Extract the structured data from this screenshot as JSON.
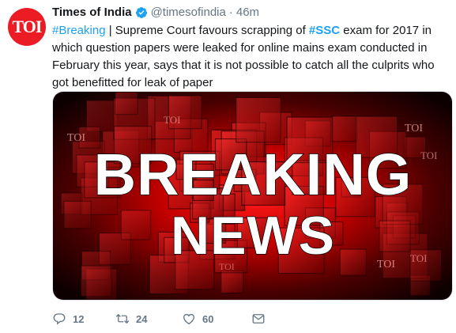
{
  "account": {
    "avatar_text": "TOI",
    "name": "Times of India",
    "handle": "@timesofindia",
    "separator": "·",
    "time": "46m"
  },
  "tweet": {
    "hashtag_breaking": "#Breaking",
    "part1": " | Supreme Court favours scrapping of ",
    "hashtag_ssc": "#SSC",
    "part2": " exam for 2017 in which question papers were leaked for online mains exam conducted in February this year, says that it is not possible to catch all the culprits who got benefitted for leak of paper"
  },
  "media": {
    "headline_line1": "BREAKING",
    "headline_line2": "NEWS",
    "watermark": "TOI"
  },
  "actions": {
    "reply_count": "12",
    "retweet_count": "24",
    "like_count": "60"
  },
  "colors": {
    "brand_red": "#ec1c24",
    "link_blue": "#1da1f2",
    "muted_gray": "#657786"
  },
  "icons": [
    "verified-badge-icon",
    "reply-icon",
    "retweet-icon",
    "like-icon",
    "direct-message-icon"
  ]
}
